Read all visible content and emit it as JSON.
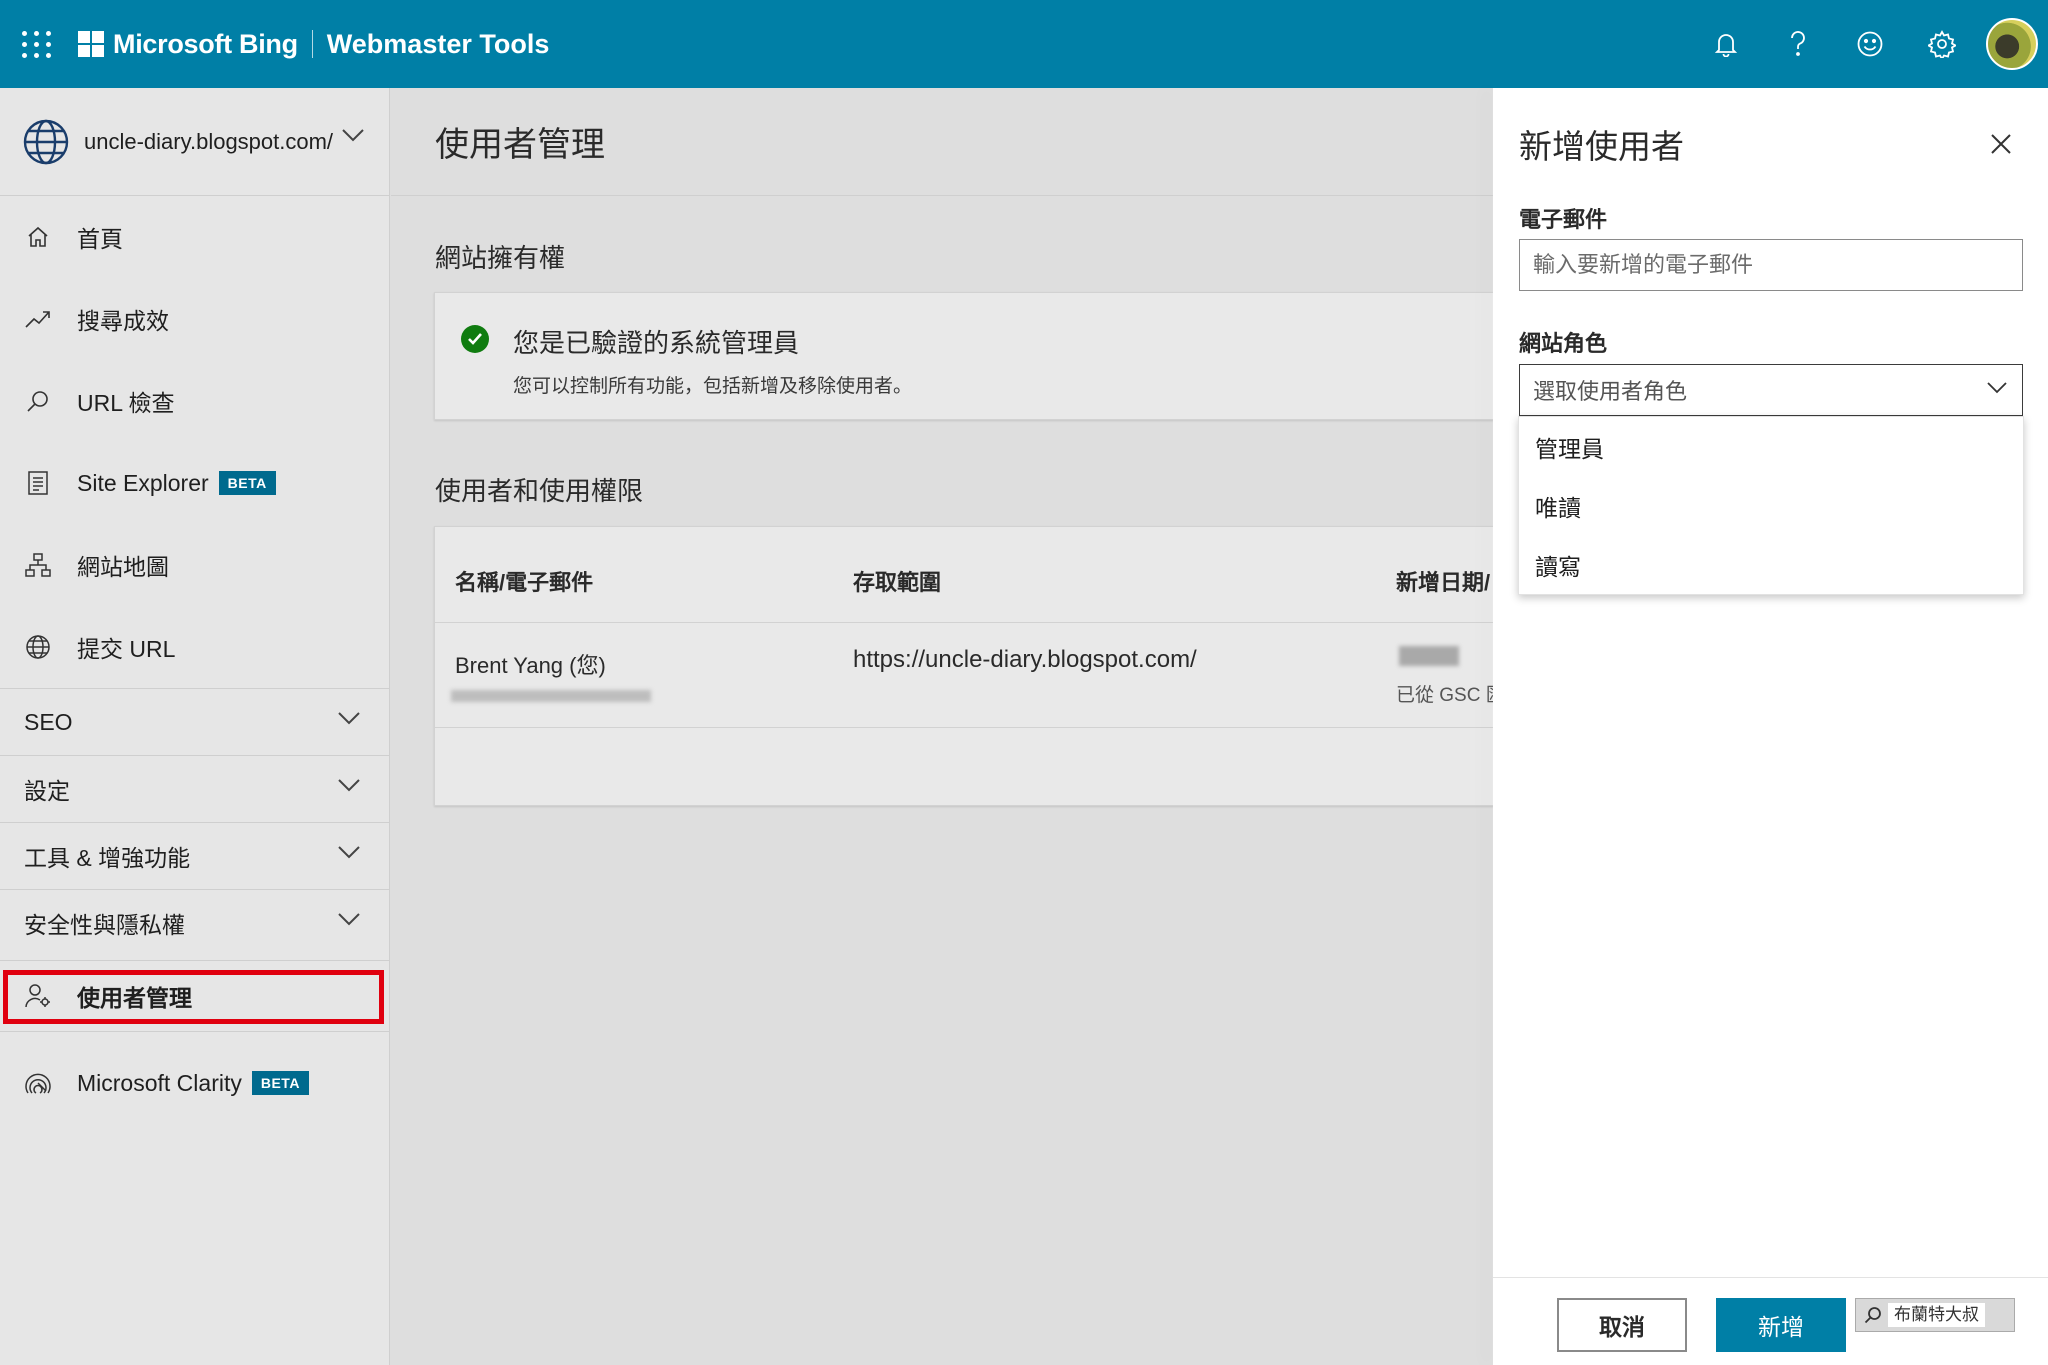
{
  "topbar": {
    "brand": "Microsoft Bing",
    "product": "Webmaster Tools",
    "icons": [
      "bell-icon",
      "help-icon",
      "feedback-smiley-icon",
      "settings-gear-icon"
    ]
  },
  "sidebar": {
    "site": "uncle-diary.blogspot.com/",
    "items": [
      {
        "label": "首頁",
        "icon": "home-icon"
      },
      {
        "label": "搜尋成效",
        "icon": "trend-icon"
      },
      {
        "label": "URL 檢查",
        "icon": "search-icon"
      },
      {
        "label": "Site Explorer",
        "icon": "document-icon",
        "badge": "BETA"
      },
      {
        "label": "網站地圖",
        "icon": "sitemap-icon"
      },
      {
        "label": "提交 URL",
        "icon": "globe-icon"
      }
    ],
    "groups": [
      {
        "label": "SEO"
      },
      {
        "label": "設定"
      },
      {
        "label": "工具 & 增強功能"
      },
      {
        "label": "安全性與隱私權"
      }
    ],
    "active_item": {
      "label": "使用者管理",
      "icon": "user-settings-icon"
    },
    "clarity": {
      "label": "Microsoft Clarity",
      "badge": "BETA",
      "icon": "clarity-icon"
    }
  },
  "main": {
    "title": "使用者管理",
    "ownership": {
      "section_title": "網站擁有權",
      "heading": "您是已驗證的系統管理員",
      "description": "您可以控制所有功能，包括新增及移除使用者。"
    },
    "users": {
      "section_title": "使用者和使用權限",
      "columns": [
        "名稱/電子郵件",
        "存取範圍",
        "新增日期/"
      ],
      "rows": [
        {
          "name": "Brent Yang (您)",
          "scope": "https://uncle-diary.blogspot.com/",
          "date_note": "已從 GSC 匯"
        }
      ]
    }
  },
  "panel": {
    "title": "新增使用者",
    "email_label": "電子郵件",
    "email_placeholder": "輸入要新增的電子郵件",
    "role_label": "網站角色",
    "role_placeholder": "選取使用者角色",
    "role_options": [
      "管理員",
      "唯讀",
      "讀寫"
    ],
    "cancel_label": "取消",
    "add_label": "新增",
    "watermark": "布蘭特大叔"
  },
  "colors": {
    "brand_blue": "#007fa6",
    "beta_badge": "#006a8e",
    "verified_green": "#107c10",
    "highlight_red": "#e0000f"
  }
}
